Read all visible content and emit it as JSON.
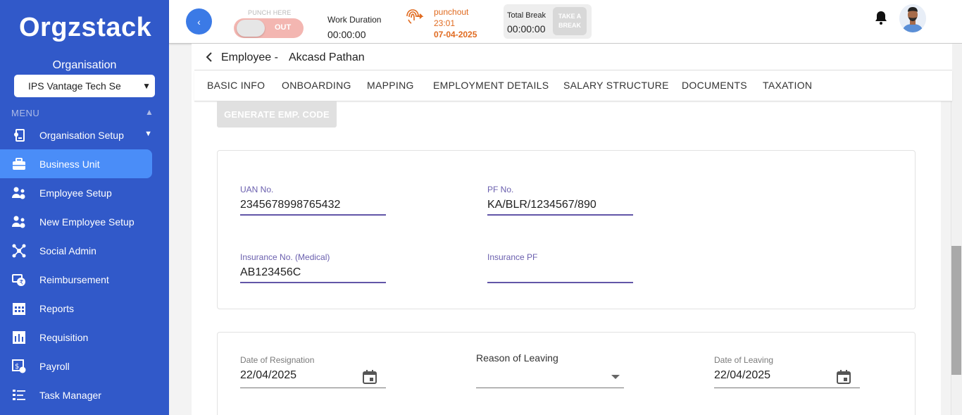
{
  "app": {
    "logo_text": "Orgzstack"
  },
  "sidebar": {
    "org_label": "Organisation",
    "org_selected": "IPS Vantage Tech Se",
    "menu_heading": "MENU",
    "items": [
      {
        "label": "Organisation Setup",
        "icon": "org-setup-icon"
      },
      {
        "label": "Business Unit",
        "icon": "briefcase-icon"
      },
      {
        "label": "Employee Setup",
        "icon": "employee-setup-icon"
      },
      {
        "label": "New Employee Setup",
        "icon": "new-employee-icon"
      },
      {
        "label": "Social Admin",
        "icon": "social-icon"
      },
      {
        "label": "Reimbursement",
        "icon": "reimbursement-icon"
      },
      {
        "label": "Reports",
        "icon": "reports-icon"
      },
      {
        "label": "Requisition",
        "icon": "requisition-icon"
      },
      {
        "label": "Payroll",
        "icon": "payroll-icon"
      },
      {
        "label": "Task Manager",
        "icon": "task-icon"
      }
    ],
    "active_item": "Business Unit"
  },
  "header": {
    "back_glyph": "‹",
    "punch_here": "PUNCH HERE",
    "punch_state": "OUT",
    "work_duration_label": "Work Duration",
    "work_duration_value": "00:00:00",
    "punchout_label": "punchout",
    "punchout_time": "23:01",
    "punchout_date": "07-04-2025",
    "total_break_label": "Total Break",
    "total_break_value": "00:00:00",
    "take_break_label": "TAKE A BREAK",
    "colors": {
      "accent": "#3b7ae6",
      "punch": "#e06a1f"
    }
  },
  "employee": {
    "title": "Employee -",
    "name": "Akcasd Pathan",
    "tabs": [
      "BASIC INFO",
      "ONBOARDING",
      "MAPPING",
      "EMPLOYMENT DETAILS",
      "SALARY STRUCTURE",
      "DOCUMENTS",
      "TAXATION"
    ]
  },
  "actions": {
    "generate_code": "GENERATE EMP. CODE"
  },
  "statutory": {
    "uan_label": "UAN No.",
    "uan_value": "2345678998765432",
    "pf_label": "PF No.",
    "pf_value": "KA/BLR/1234567/890",
    "insurance_label": "Insurance No. (Medical)",
    "insurance_value": "AB123456C",
    "insurance_pf_label": "Insurance PF",
    "insurance_pf_value": ""
  },
  "separation": {
    "resignation_label": "Date of Resignation",
    "resignation_value": "22/04/2025",
    "reason_label": "Reason of Leaving",
    "reason_value": "",
    "leaving_label": "Date of Leaving",
    "leaving_value": "22/04/2025"
  }
}
